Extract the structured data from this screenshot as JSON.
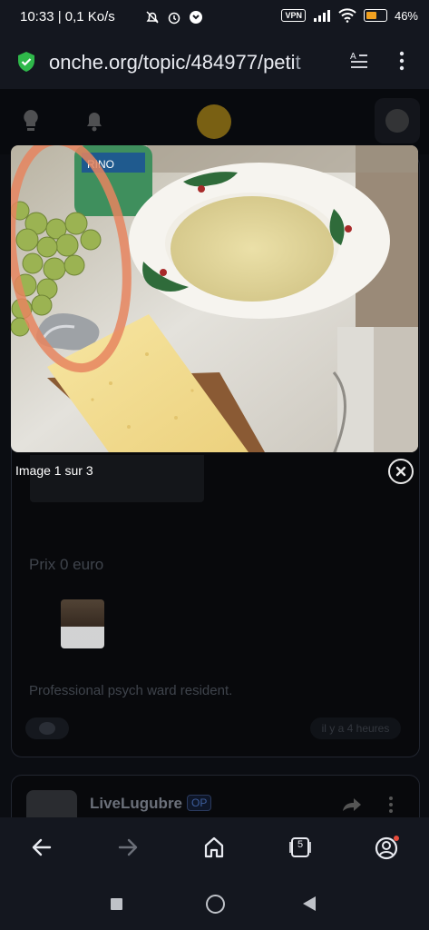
{
  "status_bar": {
    "time": "10:33 | 0,1 Ko/s",
    "vpn": "VPN",
    "battery": "46%"
  },
  "browser": {
    "url_main": "onche.org/topic/484977/peti",
    "url_fade": "t"
  },
  "viewer": {
    "counter": "Image 1 sur 3"
  },
  "post": {
    "price": "Prix 0 euro",
    "bio": "Professional psych ward resident.",
    "time_ago": "il y a 4 heures"
  },
  "next_post": {
    "username": "LiveLugubre",
    "badge": "OP"
  },
  "bottom_nav": {
    "tab_count": "5"
  }
}
